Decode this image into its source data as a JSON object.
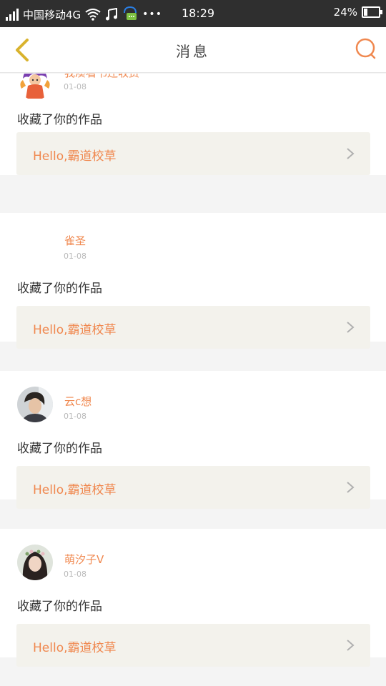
{
  "status_bar": {
    "carrier": "中国移动4G",
    "time": "18:29",
    "battery_text": "24%",
    "battery_level": 0.24,
    "icons": [
      "signal-icon",
      "wifi-icon",
      "music-icon",
      "chat-notification-icon",
      "more-dots-icon",
      "battery-icon"
    ]
  },
  "nav": {
    "title": "消息",
    "back_icon": "chevron-left-icon",
    "search_icon": "search-icon",
    "accent_color": "#f0884f",
    "back_color": "#d9b32e"
  },
  "feed": {
    "items": [
      {
        "user": "我凑看书还收费",
        "date": "01-08",
        "action": "收藏了你的作品",
        "work_title": "Hello,霸道校草",
        "avatar": "anime-character-avatar"
      },
      {
        "user": "雀圣",
        "date": "01-08",
        "action": "收藏了你的作品",
        "work_title": "Hello,霸道校草",
        "avatar": "blank-avatar"
      },
      {
        "user": "云c想",
        "date": "01-08",
        "action": "收藏了你的作品",
        "work_title": "Hello,霸道校草",
        "avatar": "photo-avatar-boy"
      },
      {
        "user": "萌汐子V",
        "date": "01-08",
        "action": "收藏了你的作品",
        "work_title": "Hello,霸道校草",
        "avatar": "photo-avatar-girl"
      }
    ]
  }
}
